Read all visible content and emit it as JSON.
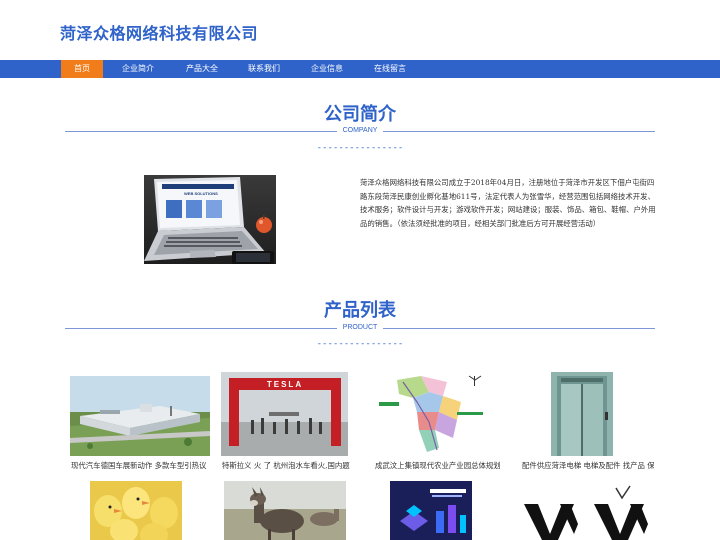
{
  "site": {
    "logo": "菏泽众格网络科技有限公司"
  },
  "nav": {
    "items": [
      {
        "label": "首页",
        "active": true
      },
      {
        "label": "企业简介"
      },
      {
        "label": "产品大全"
      },
      {
        "label": "联系我们"
      },
      {
        "label": "企业信息"
      },
      {
        "label": "在线留言"
      }
    ]
  },
  "about": {
    "title": "公司简介",
    "subtitle": "COMPANY",
    "dashes": "----------------",
    "text": "菏泽众格网络科技有限公司成立于2018年04月日，注册地位于菏泽市开发区下佃户屯街四路东段菏泽民康创业孵化基地611号，法定代表人为张雪华，经营范围包括网络技术开发、技术服务；软件设计与开发；游戏软件开发；网站建设；服装、饰品、箱包、鞋帽、户外用品的销售。（依法须经批准的项目，经相关部门批准后方可开展经营活动）",
    "laptop_screen_text": "WEB SOLUTIONS"
  },
  "products": {
    "title": "产品列表",
    "subtitle": "PRODUCT",
    "dashes": "----------------",
    "items": [
      {
        "caption": "现代汽车德国车展新动作 多款车型引热议"
      },
      {
        "caption": "特斯拉义 火 了 杭州泡水车看火,国内题败"
      },
      {
        "caption": "成武汶上集镇现代农业产业园总体规划"
      },
      {
        "caption": "配件供应菏泽电梯 电梯及配件 找产品 保"
      },
      {
        "caption": ""
      },
      {
        "caption": ""
      },
      {
        "caption": ""
      },
      {
        "caption": ""
      }
    ],
    "tesla_sign": "TESLA"
  },
  "colors": {
    "brand_blue": "#2f63c9",
    "nav_active": "#f07c1a"
  }
}
